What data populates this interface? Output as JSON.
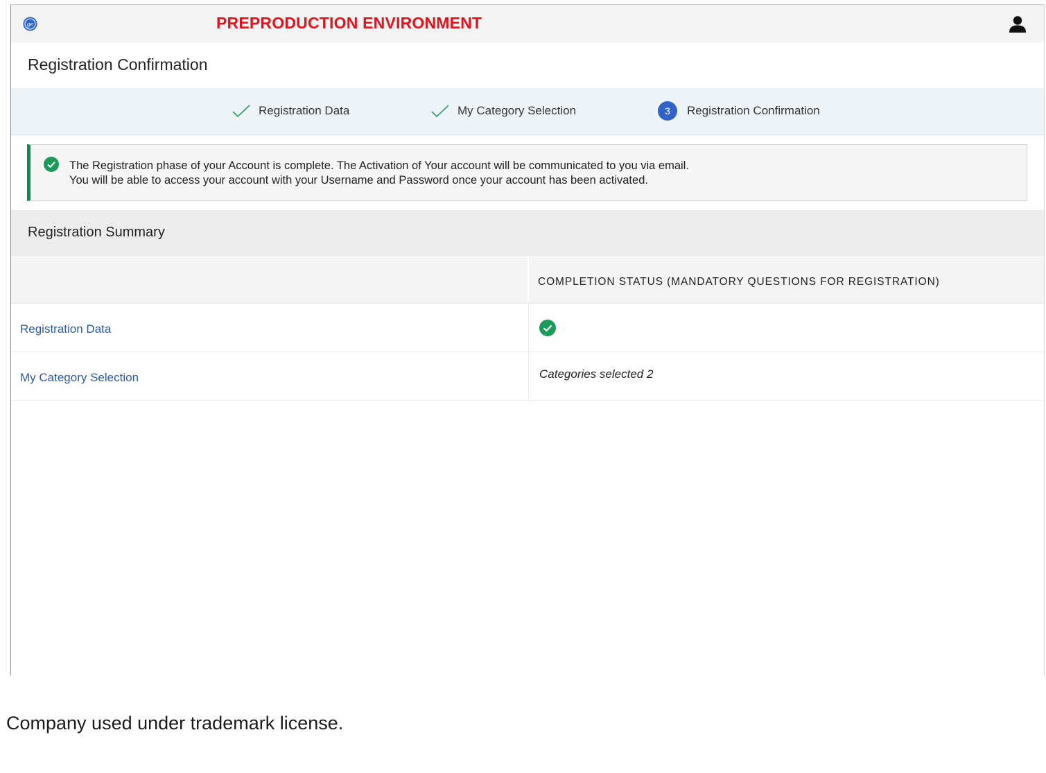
{
  "header": {
    "logo": "ge-logo-icon",
    "environment_title": "PREPRODUCTION ENVIRONMENT",
    "user_icon": "user-icon"
  },
  "page": {
    "title": "Registration Confirmation"
  },
  "stepper": {
    "steps": [
      {
        "label": "Registration Data",
        "state": "complete",
        "icon": "checkmark-icon"
      },
      {
        "label": "My Category Selection",
        "state": "complete",
        "icon": "checkmark-icon"
      },
      {
        "label": "Registration Confirmation",
        "state": "current",
        "number": "3"
      }
    ]
  },
  "notice": {
    "icon": "success-check-icon",
    "line1": "The Registration phase of your Account is complete. The Activation of Your account will be communicated to you via email.",
    "line2": "You will be able to access your account with your Username and Password once your account has been activated."
  },
  "summary": {
    "title": "Registration Summary",
    "column_header": "COMPLETION STATUS (MANDATORY QUESTIONS FOR REGISTRATION)",
    "rows": [
      {
        "label": "Registration Data",
        "status": "complete",
        "status_icon": "success-check-icon"
      },
      {
        "label": "My Category Selection",
        "status_text": "Categories selected 2"
      }
    ]
  },
  "footer": {
    "text": "Company used under trademark license."
  },
  "colors": {
    "env_title": "#e3121b",
    "step_number_bg": "#2f63c7",
    "success_green": "#118a4e",
    "link_blue": "#2c5aa0",
    "stepper_bg": "#eef3f8"
  }
}
